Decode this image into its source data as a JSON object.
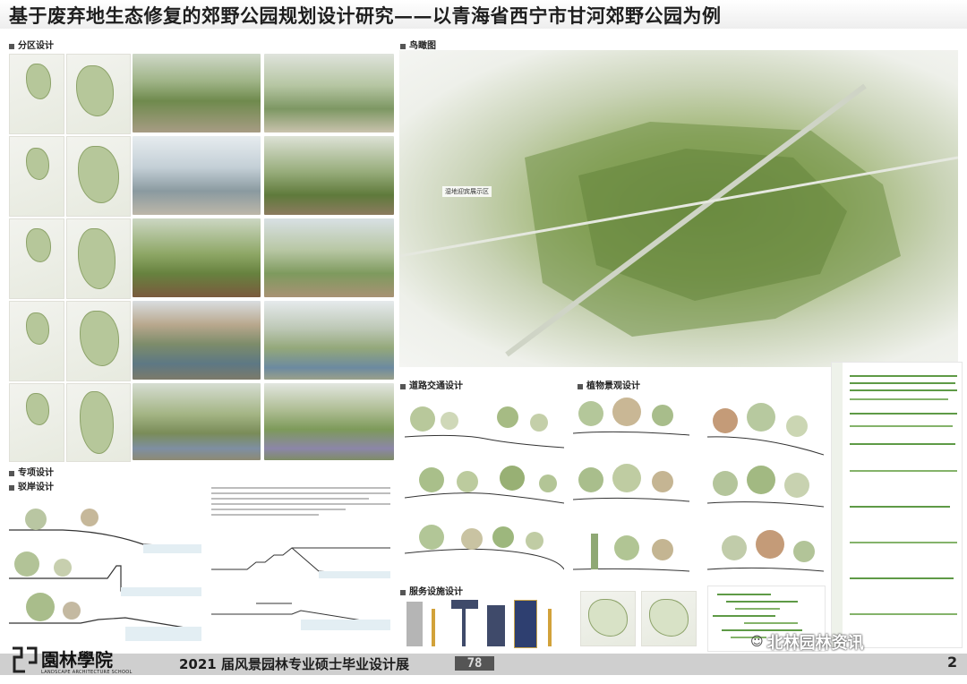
{
  "header": {
    "title": "基于废弃地生态修复的郊野公园规划设计研究——以青海省西宁市甘河郊野公园为例"
  },
  "sections": {
    "zoning": "分区设计",
    "aerial": "鸟瞰图",
    "special": "专项设计",
    "revetment": "驳岸设计",
    "road": "道路交通设计",
    "planting": "植物景观设计",
    "service": "服务设施设计"
  },
  "aerial_label": "湿地迎宾展示区",
  "footer": {
    "school_logo_text": "園林學院",
    "school_en": "LANDSCAPE ARCHITECTURE SCHOOL",
    "exhibition": "2021 届风景园林专业硕士毕业设计展",
    "page_number": "78",
    "watermark": "北林园林资讯",
    "corner_number": "2"
  },
  "colors": {
    "title_bar": "#eeeeee",
    "footer_bar": "#cfcfcf",
    "vegetation": "#7f9d52",
    "gantt_green": "#5e9a46"
  }
}
